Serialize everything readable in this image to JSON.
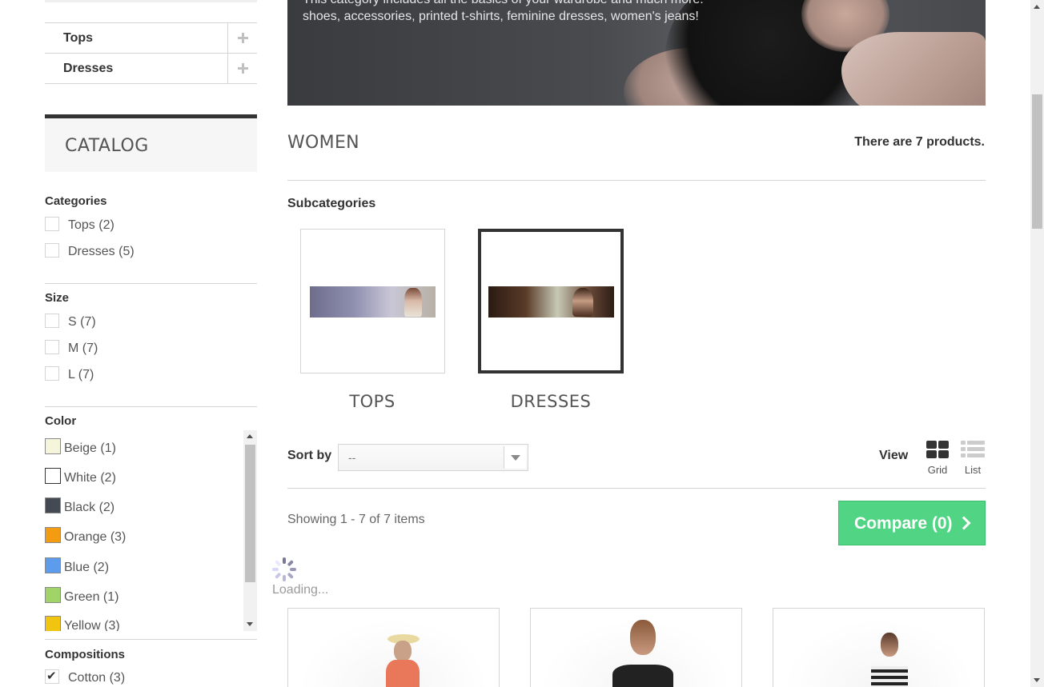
{
  "category_tree": {
    "items": [
      {
        "label": "Tops"
      },
      {
        "label": "Dresses"
      }
    ]
  },
  "catalog": {
    "title": "CATALOG",
    "categories": {
      "title": "Categories",
      "options": [
        {
          "label": "Tops (2)",
          "checked": false
        },
        {
          "label": "Dresses (5)",
          "checked": false
        }
      ]
    },
    "size": {
      "title": "Size",
      "options": [
        {
          "label": "S (7)",
          "checked": false
        },
        {
          "label": "M (7)",
          "checked": false
        },
        {
          "label": "L (7)",
          "checked": false
        }
      ]
    },
    "color": {
      "title": "Color",
      "options": [
        {
          "label": "Beige (1)",
          "swatch": "#f5f5dc"
        },
        {
          "label": "White (2)",
          "swatch": "#ffffff"
        },
        {
          "label": "Black (2)",
          "swatch": "#434a54"
        },
        {
          "label": "Orange (3)",
          "swatch": "#f39c11"
        },
        {
          "label": "Blue (2)",
          "swatch": "#5d9cec"
        },
        {
          "label": "Green (1)",
          "swatch": "#a0d468"
        },
        {
          "label": "Yellow (3)",
          "swatch": "#f1c40f"
        }
      ]
    },
    "compositions": {
      "title": "Compositions",
      "options": [
        {
          "label": "Cotton (3)",
          "checked": true
        }
      ]
    }
  },
  "banner": {
    "line1": "This category includes all the basics of your wardrobe and much more:",
    "line2": "shoes, accessories, printed t-shirts, feminine dresses, women's jeans!"
  },
  "heading": {
    "title": "WOMEN",
    "product_count": "There are 7 products."
  },
  "subcategories": {
    "title": "Subcategories",
    "items": [
      {
        "name": "TOPS",
        "selected": false
      },
      {
        "name": "DRESSES",
        "selected": true
      }
    ]
  },
  "toolbar": {
    "sort_label": "Sort by",
    "sort_value": "--",
    "view_label": "View",
    "views": [
      {
        "label": "Grid",
        "active": true
      },
      {
        "label": "List",
        "active": false
      }
    ]
  },
  "listing": {
    "showing": "Showing 1 - 7 of 7 items",
    "compare_label": "Compare (0)",
    "loading_text": "Loading..."
  },
  "colors": {
    "accent_green": "#52d485",
    "dark": "#333333",
    "border": "#d6d4d4"
  }
}
